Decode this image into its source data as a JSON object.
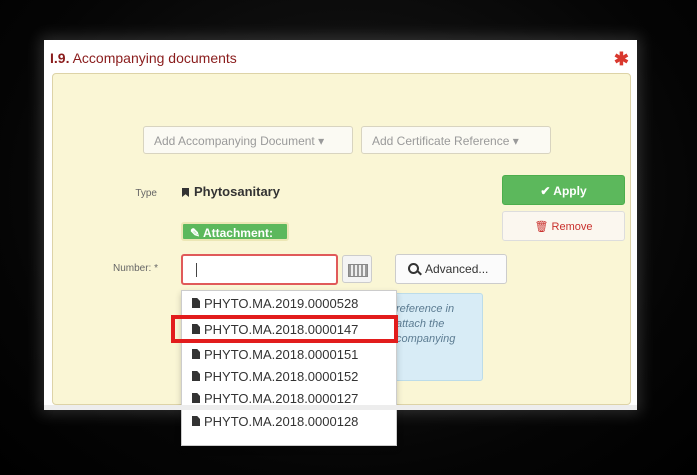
{
  "section": {
    "number": "I.9.",
    "title": "Accompanying documents",
    "required_mark": "✱"
  },
  "toolbar": {
    "add_document": "Add Accompanying Document ▾",
    "add_certificate": "Add Certificate Reference ▾"
  },
  "form": {
    "type_label": "Type",
    "type_value": "Phytosanitary",
    "attachment_badge": "✎ Attachment:",
    "number_label": "Number: *",
    "number_value": "",
    "apply_label": "✔ Apply",
    "remove_label": "🗑 Remove",
    "advanced_label": "Advanced..."
  },
  "info_text": [
    "reference in",
    "attach the",
    "companying"
  ],
  "dropdown": {
    "items": [
      "PHYTO.MA.2019.0000528",
      "PHYTO.MA.2018.0000147",
      "PHYTO.MA.2018.0000151",
      "PHYTO.MA.2018.0000152",
      "PHYTO.MA.2018.0000127",
      "PHYTO.MA.2018.0000128"
    ],
    "highlighted_index": 1
  },
  "colors": {
    "title": "#8a1c1c",
    "apply": "#5cb85c",
    "remove_text": "#c9302c",
    "highlight": "#e21c1c",
    "panel_bg": "#faf6d5",
    "info_bg": "#d8ecf6"
  },
  "icons": {
    "type": "bookmark-icon",
    "search": "search-icon",
    "keyboard": "keyboard-icon",
    "document": "document-icon"
  }
}
